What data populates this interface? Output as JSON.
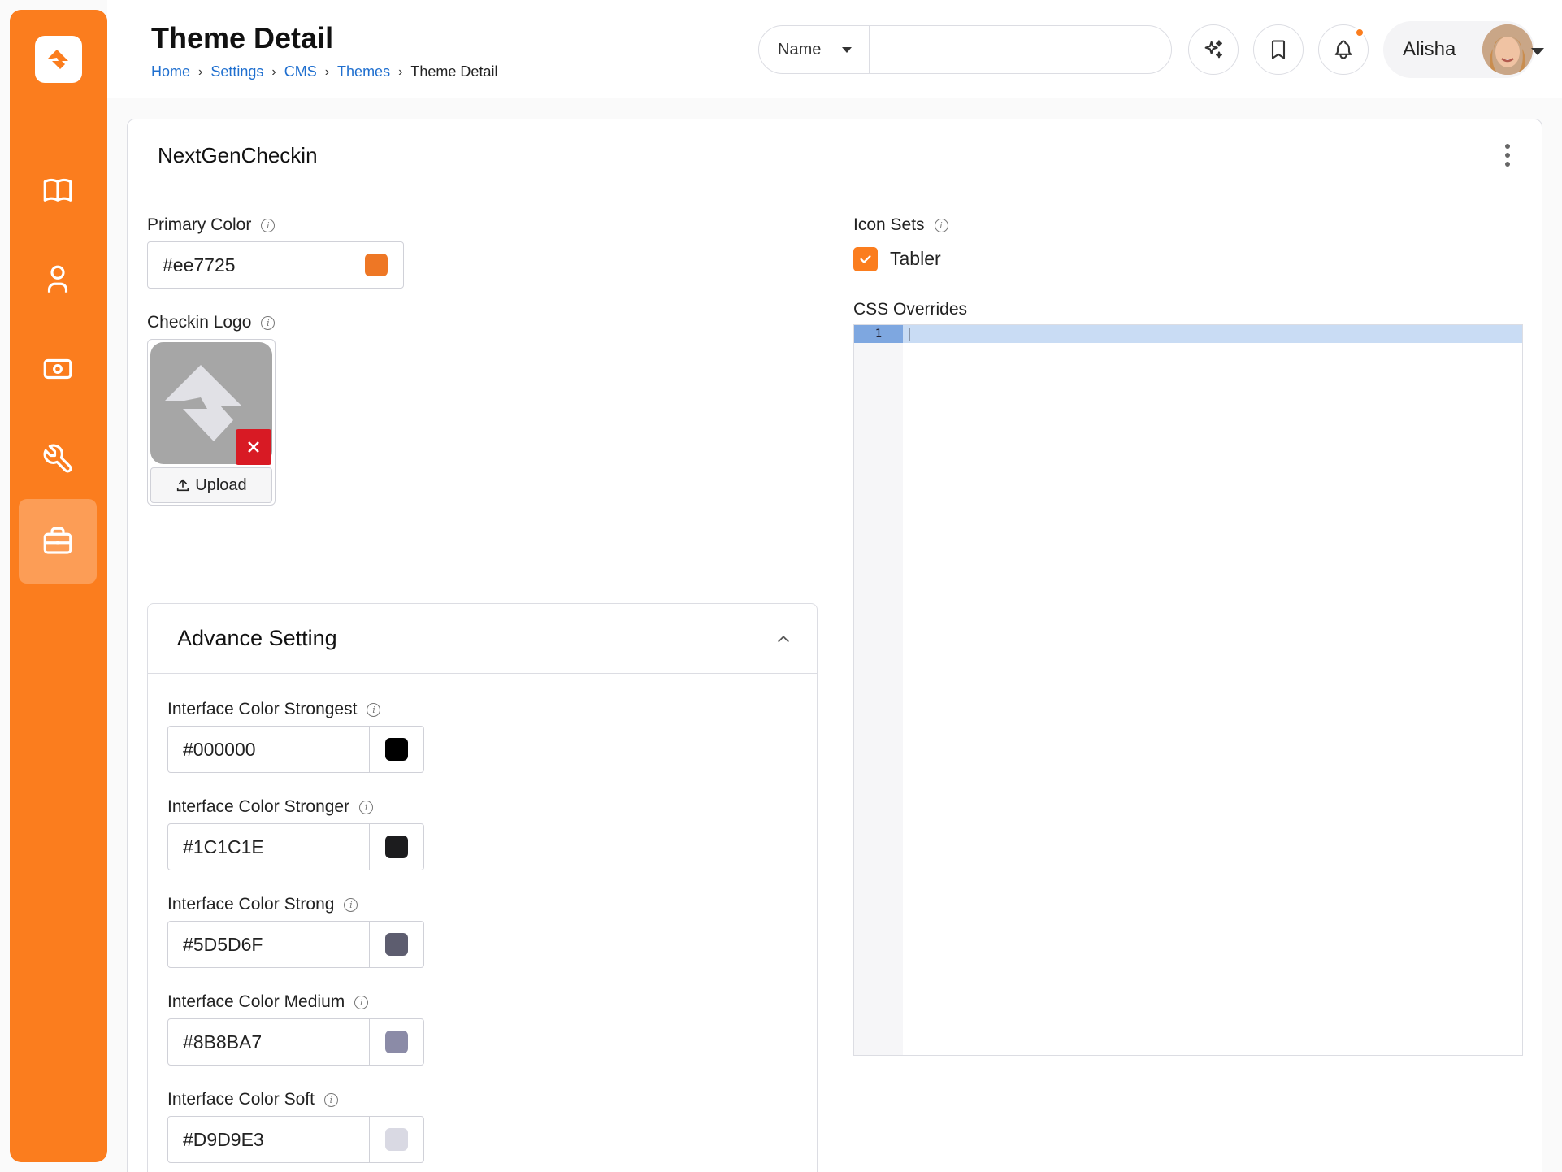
{
  "header": {
    "title": "Theme Detail",
    "breadcrumb": [
      "Home",
      "Settings",
      "CMS",
      "Themes"
    ],
    "breadcrumb_current": "Theme Detail",
    "search_select": "Name",
    "search_placeholder": "",
    "user_name": "Alisha"
  },
  "sidebar": {
    "accent": "#fb7d1e",
    "items": [
      {
        "icon": "book-icon"
      },
      {
        "icon": "user-icon"
      },
      {
        "icon": "cash-icon"
      },
      {
        "icon": "tool-icon"
      },
      {
        "icon": "briefcase-icon",
        "active": true
      }
    ]
  },
  "card": {
    "title": "NextGenCheckin",
    "primary_color": {
      "label": "Primary Color",
      "value": "#ee7725",
      "swatch": "#ee7725"
    },
    "logo": {
      "label": "Checkin Logo",
      "upload_label": "Upload"
    },
    "icon_sets": {
      "label": "Icon Sets",
      "option": "Tabler",
      "checked": true
    },
    "css_overrides": {
      "label": "CSS Overrides",
      "line_number": "1"
    },
    "advance": {
      "title": "Advance Setting",
      "fields": [
        {
          "label": "Interface Color Strongest",
          "value": "#000000",
          "swatch": "#000000"
        },
        {
          "label": "Interface Color Stronger",
          "value": "#1C1C1E",
          "swatch": "#1C1C1E"
        },
        {
          "label": "Interface Color Strong",
          "value": "#5D5D6F",
          "swatch": "#5D5D6F"
        },
        {
          "label": "Interface Color Medium",
          "value": "#8B8BA7",
          "swatch": "#8B8BA7"
        },
        {
          "label": "Interface Color Soft",
          "value": "#D9D9E3",
          "swatch": "#D9D9E3"
        }
      ]
    }
  }
}
